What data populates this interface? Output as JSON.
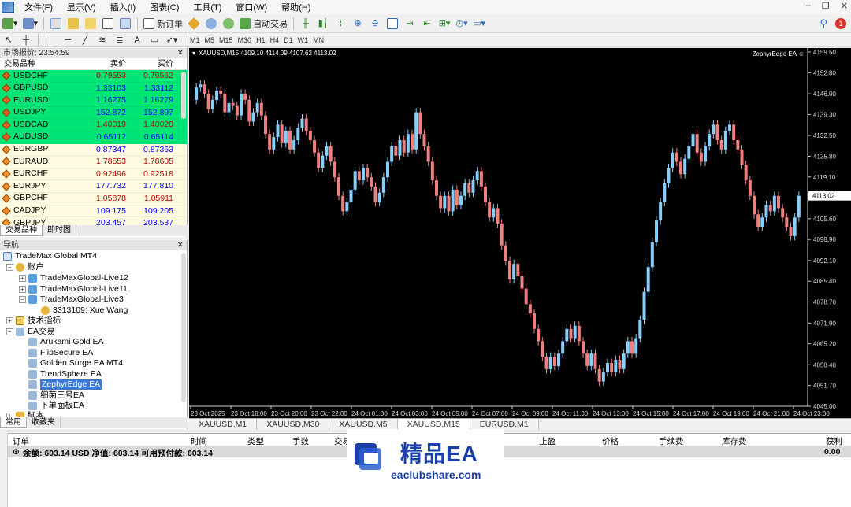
{
  "menubar": {
    "items": [
      "文件(F)",
      "显示(V)",
      "插入(I)",
      "图表(C)",
      "工具(T)",
      "窗口(W)",
      "帮助(H)"
    ]
  },
  "toolbar": {
    "new_order": "新订单",
    "auto_trading": "自动交易",
    "timeframes": [
      "M1",
      "M5",
      "M15",
      "M30",
      "H1",
      "H4",
      "D1",
      "W1",
      "MN"
    ],
    "notification_count": "1"
  },
  "market_watch": {
    "title": "市场报价: 23:54:59",
    "col_symbol": "交易品种",
    "col_bid": "卖价",
    "col_ask": "买价",
    "rows": [
      {
        "symbol": "USDCHF",
        "bid": "0.79553",
        "ask": "0.79562",
        "bid_color": "#c00000",
        "ask_color": "#c00000",
        "bg": "#00e676"
      },
      {
        "symbol": "GBPUSD",
        "bid": "1.33103",
        "ask": "1.33112",
        "bid_color": "#0000ff",
        "ask_color": "#0000ff",
        "bg": "#00e676"
      },
      {
        "symbol": "EURUSD",
        "bid": "1.16275",
        "ask": "1.16279",
        "bid_color": "#0000ff",
        "ask_color": "#0000ff",
        "bg": "#00e676"
      },
      {
        "symbol": "USDJPY",
        "bid": "152.872",
        "ask": "152.897",
        "bid_color": "#0000ff",
        "ask_color": "#0000ff",
        "bg": "#00e676"
      },
      {
        "symbol": "USDCAD",
        "bid": "1.40019",
        "ask": "1.40028",
        "bid_color": "#c00000",
        "ask_color": "#c00000",
        "bg": "#00e676"
      },
      {
        "symbol": "AUDUSD",
        "bid": "0.65112",
        "ask": "0.65114",
        "bid_color": "#0000ff",
        "ask_color": "#0000ff",
        "bg": "#00e676"
      },
      {
        "symbol": "EURGBP",
        "bid": "0.87347",
        "ask": "0.87363",
        "bid_color": "#0000ff",
        "ask_color": "#0000ff",
        "bg": "#fffbe0"
      },
      {
        "symbol": "EURAUD",
        "bid": "1.78553",
        "ask": "1.78605",
        "bid_color": "#c00000",
        "ask_color": "#c00000",
        "bg": "#fffbe0"
      },
      {
        "symbol": "EURCHF",
        "bid": "0.92496",
        "ask": "0.92518",
        "bid_color": "#c00000",
        "ask_color": "#c00000",
        "bg": "#fffbe0"
      },
      {
        "symbol": "EURJPY",
        "bid": "177.732",
        "ask": "177.810",
        "bid_color": "#0000ff",
        "ask_color": "#0000ff",
        "bg": "#fffbe0"
      },
      {
        "symbol": "GBPCHF",
        "bid": "1.05878",
        "ask": "1.05911",
        "bid_color": "#c00000",
        "ask_color": "#c00000",
        "bg": "#fffbe0"
      },
      {
        "symbol": "CADJPY",
        "bid": "109.175",
        "ask": "109.205",
        "bid_color": "#0000ff",
        "ask_color": "#0000ff",
        "bg": "#fffbe0"
      },
      {
        "symbol": "GBPJPY",
        "bid": "203.457",
        "ask": "203.537",
        "bid_color": "#0000ff",
        "ask_color": "#0000ff",
        "bg": "#fffbe0"
      }
    ],
    "tabs": [
      "交易品种",
      "即时图"
    ]
  },
  "navigator": {
    "title": "导航",
    "root": "TradeMax Global MT4",
    "accounts_label": "账户",
    "accounts": [
      "TradeMaxGlobal-Live12",
      "TradeMaxGlobal-Live11",
      "TradeMaxGlobal-Live3"
    ],
    "account_user": "3313109: Xue Wang",
    "indicators_label": "技术指标",
    "ea_label": "EA交易",
    "eas": [
      "Arukami Gold EA",
      "FlipSecure EA",
      "Golden Surge EA MT4",
      "TrendSphere EA",
      "ZephyrEdge EA",
      "细菌三号EA",
      "下单面板EA"
    ],
    "scripts_label": "脚本",
    "tabs": [
      "常用",
      "收藏夹"
    ]
  },
  "chart": {
    "header": "XAUUSD,M15  4109.10 4114.09 4107.62 4113.02",
    "ea_label": "ZephyrEdge EA ☺",
    "current_price": "4113.02",
    "price_ticks": [
      "4159.50",
      "4152.80",
      "4146.00",
      "4139.30",
      "4132.50",
      "4125.80",
      "4119.10",
      "4112.30",
      "4105.60",
      "4098.90",
      "4092.10",
      "4085.40",
      "4078.70",
      "4071.90",
      "4065.20",
      "4058.40",
      "4051.70",
      "4045.00"
    ],
    "time_ticks": [
      "23 Oct 2025",
      "23 Oct 18:00",
      "23 Oct 20:00",
      "23 Oct 22:00",
      "24 Oct 01:00",
      "24 Oct 03:00",
      "24 Oct 05:00",
      "24 Oct 07:00",
      "24 Oct 09:00",
      "24 Oct 11:00",
      "24 Oct 13:00",
      "24 Oct 15:00",
      "24 Oct 17:00",
      "24 Oct 19:00",
      "24 Oct 21:00",
      "24 Oct 23:00"
    ],
    "up_color": "#87cefa",
    "down_color": "#f08080",
    "bg_color": "#000000"
  },
  "chart_tabs": [
    "XAUUSD,M1",
    "XAUUSD,M30",
    "XAUUSD,M5",
    "XAUUSD,M15",
    "EURUSD,M1"
  ],
  "terminal": {
    "cols": [
      "订单",
      "时间",
      "类型",
      "手数",
      "交易",
      "止盈",
      "价格",
      "手续费",
      "库存费",
      "获利"
    ],
    "balance_line": "余额: 603.14 USD  净值: 603.14  可用预付款: 603.14",
    "profit": "0.00"
  },
  "watermark": {
    "title": "精品EA",
    "url": "eaclubshare.com"
  }
}
